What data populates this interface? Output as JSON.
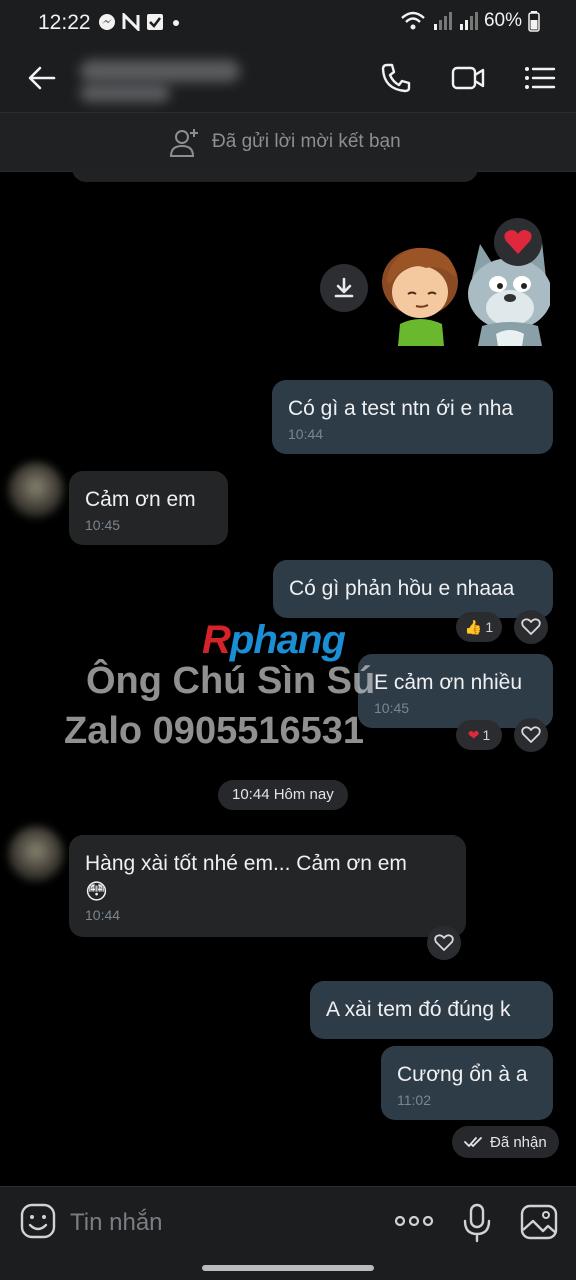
{
  "status_bar": {
    "time": "12:22",
    "battery": "60%"
  },
  "header": {
    "icons": [
      "back-arrow-icon",
      "phone-icon",
      "video-call-icon",
      "menu-list-icon"
    ]
  },
  "friend_request": {
    "text": "Đã gửi lời mời kết bạn"
  },
  "messages": [
    {
      "dir": "out",
      "text": "Có gì a test ntn ới e nha",
      "time": "10:44"
    },
    {
      "dir": "in",
      "text": "Cảm ơn em",
      "time": "10:45"
    },
    {
      "dir": "out",
      "text": "Có gì phản hồu e nhaaa",
      "reaction_count": "1"
    },
    {
      "dir": "out",
      "text": "E cảm ơn nhiều",
      "time": "10:45",
      "reaction_count": "1"
    },
    {
      "dir": "in",
      "text": "Hàng xài tốt nhé em... Cảm ơn em",
      "emoji": "😳",
      "time": "10:44"
    },
    {
      "dir": "out",
      "text": "A xài tem đó đúng k"
    },
    {
      "dir": "out",
      "text": "Cương ổn à a",
      "time": "11:02"
    }
  ],
  "date_divider": "10:44 Hôm nay",
  "delivery_status": "Đã nhận",
  "watermark": {
    "logo_r": "R",
    "logo_rest": "phang",
    "line1": "Ông Chú Sìn Sú",
    "line2": "Zalo 0905516531"
  },
  "input": {
    "placeholder": "Tin nhắn"
  },
  "colors": {
    "bubble_out": "#2e3c48",
    "bubble_in": "#232527",
    "background": "#000000",
    "logo_red": "#d8222a",
    "logo_blue": "#1a8fd6"
  }
}
